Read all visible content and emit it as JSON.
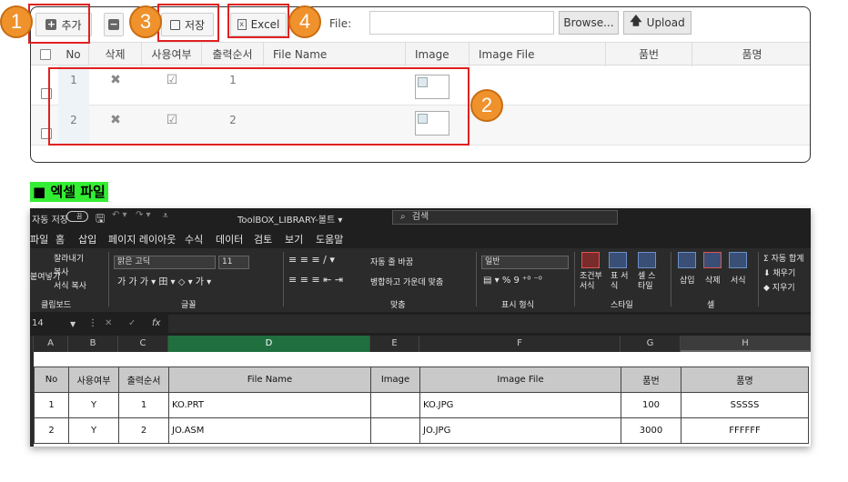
{
  "toolbar": {
    "add_label": "추가",
    "add_icon": "plus-square-icon",
    "delete_icon": "minus-square-icon",
    "save_label": "저장",
    "save_icon": "floppy-disk-icon",
    "excel_label": "Excel",
    "excel_icon": "excel-file-icon",
    "file_label": "File:",
    "file_value": "",
    "browse_label": "Browse...",
    "upload_label": "Upload",
    "upload_icon": "arrow-up-icon"
  },
  "badges": [
    "1",
    "2",
    "3",
    "4"
  ],
  "grid": {
    "headers": [
      "No",
      "삭제",
      "사용여부",
      "출력순서",
      "File Name",
      "Image",
      "Image File",
      "품번",
      "품명"
    ],
    "rows": [
      {
        "no": "1",
        "delete": "✖",
        "use": "☑",
        "order": "1",
        "file_name": "",
        "image_file": "",
        "part_no": "",
        "part_name": ""
      },
      {
        "no": "2",
        "delete": "✖",
        "use": "☑",
        "order": "2",
        "file_name": "",
        "image_file": "",
        "part_no": "",
        "part_name": ""
      }
    ]
  },
  "section_title": "■ 엑셀 파일",
  "excel": {
    "autosave": "자동 저장",
    "autosave_state": "끔",
    "workbook": "ToolBOX_LIBRARY-볼트 ▾",
    "search": "검색",
    "menu": [
      "파일",
      "홈",
      "삽입",
      "페이지 레이아웃",
      "수식",
      "데이터",
      "검토",
      "보기",
      "도움말"
    ],
    "ribbon": {
      "clipboard": "클립보드",
      "paste": "붙여넣기",
      "cut": "잘라내기",
      "copy": "복사",
      "format_painter": "서식 복사",
      "font_group": "글꼴",
      "font_name": "맑은 고딕",
      "font_size": "11",
      "align_group": "맞춤",
      "wrap": "자동 줄 바꿈",
      "merge": "병합하고 가운데 맞춤",
      "number_group": "표시 형식",
      "number_format": "일반",
      "styles_group": "스타일",
      "cond_format": "조건부 서식",
      "table_format": "표 서식",
      "cell_style": "셀 스타일",
      "cells_group": "셀",
      "insert": "삽입",
      "delete": "삭제",
      "format": "서식",
      "autosum": "자동 합계",
      "fill": "채우기",
      "clear": "지우기"
    },
    "name_box": "14",
    "fx": "fx",
    "columns": [
      "A",
      "B",
      "C",
      "D",
      "E",
      "F",
      "G",
      "H"
    ],
    "table_headers": [
      "No",
      "사용여부",
      "출력순서",
      "File Name",
      "Image",
      "Image File",
      "품번",
      "품명"
    ],
    "table_rows": [
      [
        "1",
        "Y",
        "1",
        "KO.PRT",
        "",
        "KO.JPG",
        "100",
        "SSSSS"
      ],
      [
        "2",
        "Y",
        "2",
        "JO.ASM",
        "",
        "JO.JPG",
        "3000",
        "FFFFFF"
      ]
    ]
  }
}
